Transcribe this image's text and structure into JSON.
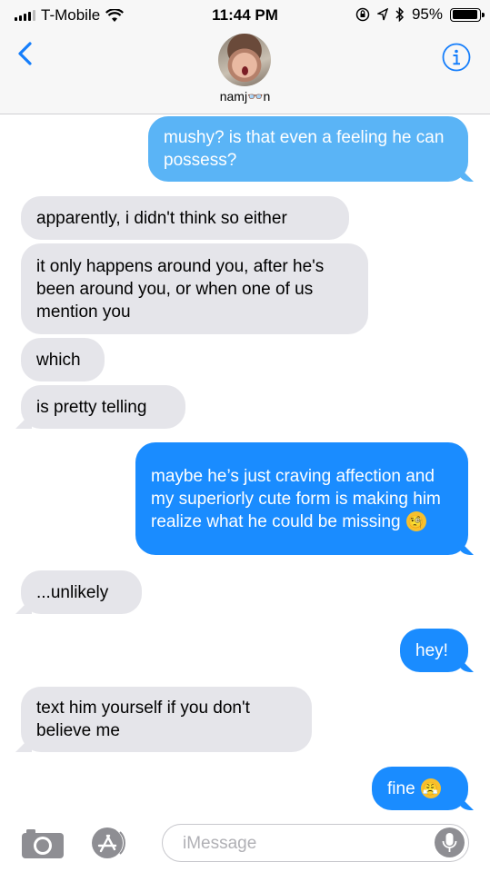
{
  "status_bar": {
    "carrier": "T-Mobile",
    "time": "11:44 PM",
    "battery": "95%",
    "battery_level": 0.95
  },
  "header": {
    "contact_name": "namj👓n",
    "back_icon": "chevron-left-icon",
    "info_icon": "info-icon"
  },
  "messages": [
    {
      "from": "me",
      "text": "mushy? is that even a feeling he can possess?"
    },
    {
      "from": "them",
      "text": "apparently, i didn't think so either"
    },
    {
      "from": "them",
      "text": "it only happens around you, after he's been around you, or when one of us mention you"
    },
    {
      "from": "them",
      "text": "which"
    },
    {
      "from": "them",
      "text": "is pretty telling"
    },
    {
      "from": "me",
      "text": "maybe he’s just craving affection and my superiorly cute form is making him realize what he could be missing",
      "emoji": "🧐"
    },
    {
      "from": "them",
      "text": "...unlikely"
    },
    {
      "from": "me",
      "text": "hey!"
    },
    {
      "from": "them",
      "text": "text him yourself if you don't believe me"
    },
    {
      "from": "me",
      "text": "fine",
      "emoji": "😤"
    }
  ],
  "composer": {
    "placeholder": "iMessage",
    "camera_icon": "camera-icon",
    "apps_icon": "app-store-icon",
    "mic_icon": "microphone-icon"
  },
  "colors": {
    "sent": "#1a8cff",
    "sent_light": "#5ab4f6",
    "received": "#e5e5ea",
    "accent": "#157efb"
  }
}
